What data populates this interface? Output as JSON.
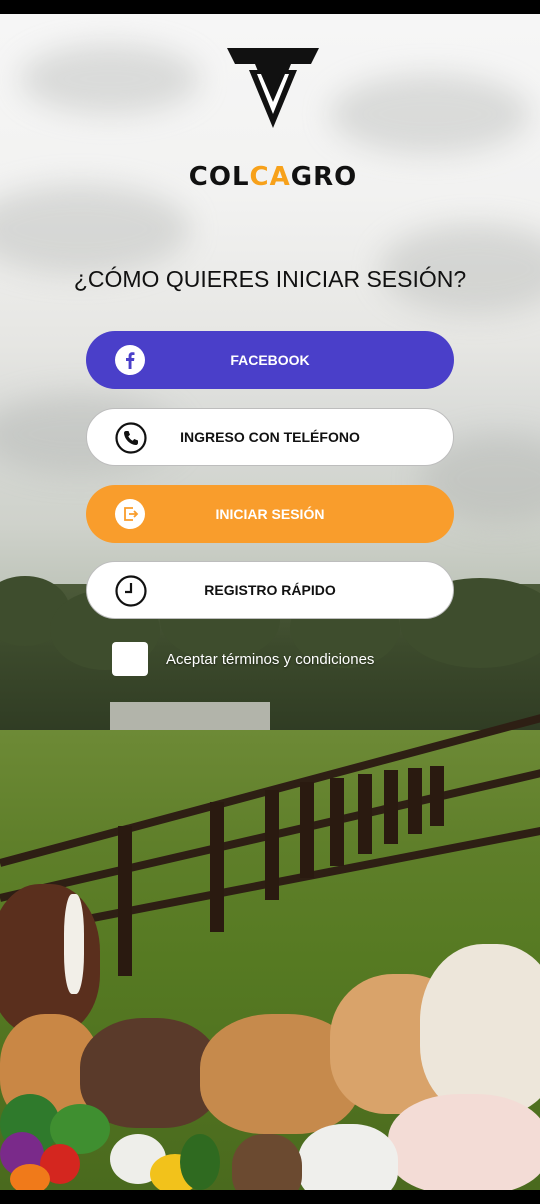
{
  "brand": {
    "name_part1": "COL",
    "name_accent": "CA",
    "name_part2": "GRO",
    "accent_color": "#f7a11a"
  },
  "headline": "¿CÓMO QUIERES INICIAR SESIÓN?",
  "buttons": {
    "facebook": {
      "label": "FACEBOOK",
      "icon": "facebook-icon",
      "color": "#4a3fc9"
    },
    "phone": {
      "label": "INGRESO CON TELÉFONO",
      "icon": "phone-icon"
    },
    "login": {
      "label": "INICIAR SESIÓN",
      "icon": "login-icon",
      "color": "#f99d2c"
    },
    "register": {
      "label": "REGISTRO RÁPIDO",
      "icon": "clock-icon"
    }
  },
  "terms": {
    "label": "Aceptar términos y condiciones",
    "checked": false
  }
}
